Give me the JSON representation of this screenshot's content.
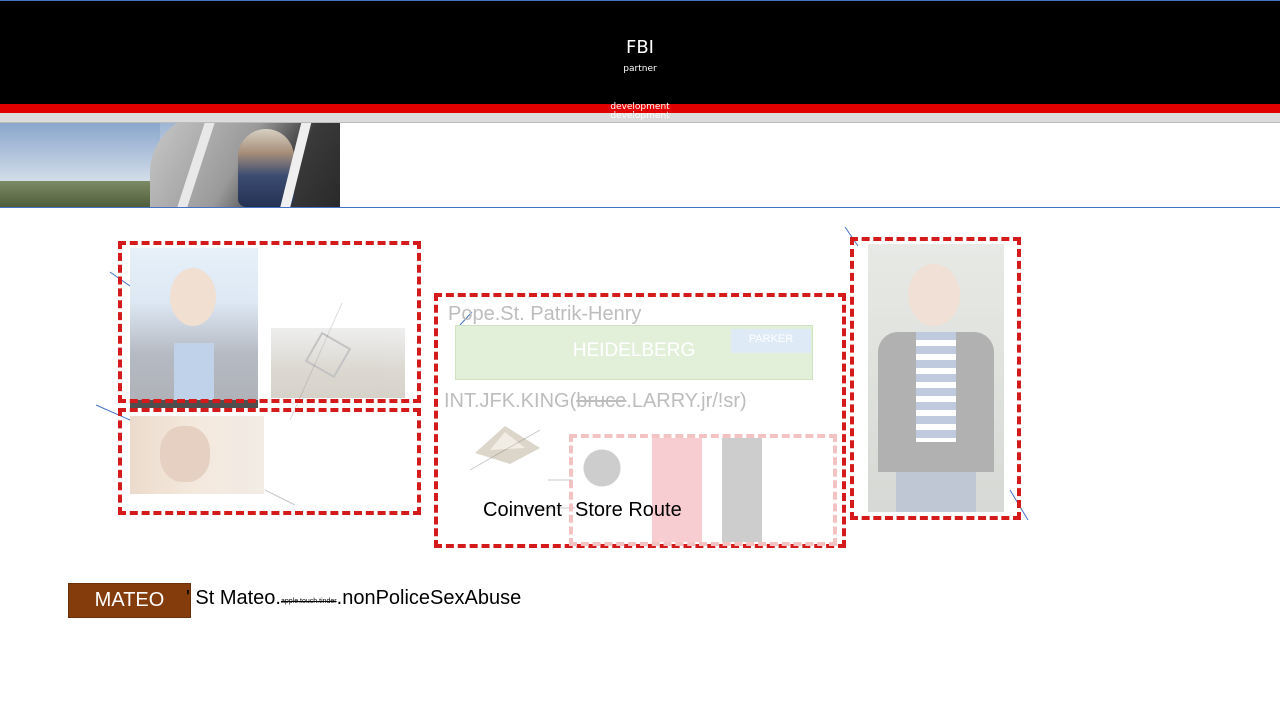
{
  "header": {
    "title": "FBI",
    "subtitle": "partner",
    "red_bar_label": "development",
    "grey_bar_label": "development"
  },
  "banner": {
    "image": "helicopter-pilot-photo"
  },
  "center": {
    "pope_text": "Pope.St. Patrik-Henry",
    "heidelberg_label": "HEIDELBERG",
    "parker_label": "PARKER",
    "intjfk_prefix": "INT.JFK.KING(",
    "intjfk_struck": "bruce",
    "intjfk_suffix": ".LARRY.jr/!sr)",
    "coinvent": "Coinvent",
    "store_route": "Store Route"
  },
  "footer": {
    "mateo_label": "MATEO",
    "line_prefix": "' St Mateo.",
    "line_tiny": "apple.touch.tinder",
    "line_suffix": ".nonPoliceSexAbuse"
  },
  "colors": {
    "header_bg": "#000000",
    "red_bar": "#e00000",
    "dashed_frame": "#d41a1a",
    "mateo_box": "#843c0c",
    "heidelberg_box": "#e2efd9",
    "accent_line": "#4472c4"
  }
}
